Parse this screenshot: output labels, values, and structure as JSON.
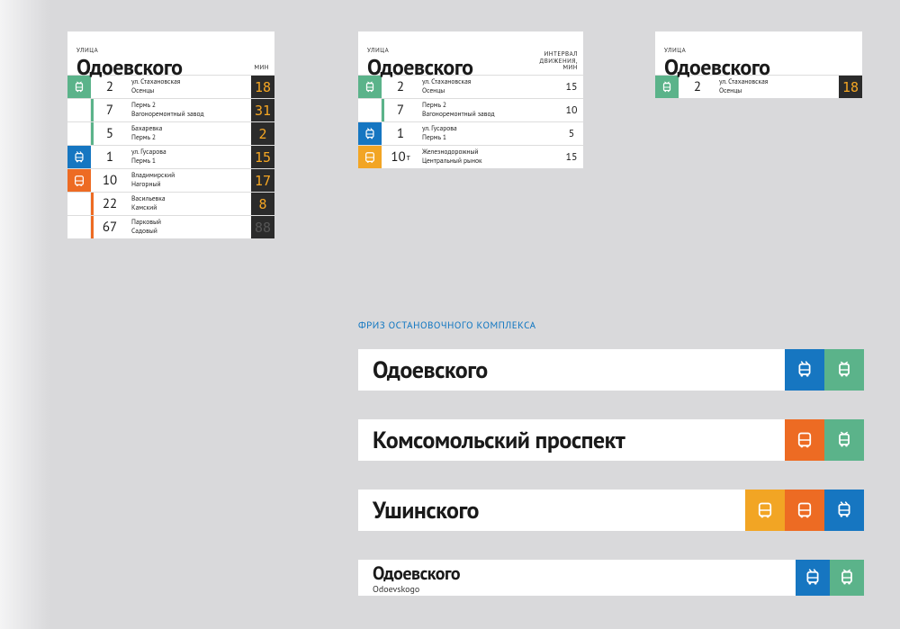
{
  "labels": {
    "street": "УЛИЦА",
    "min": "МИН",
    "interval": "ИНТЕРВАЛ ДВИЖЕНИЯ, МИН"
  },
  "panel1": {
    "title": "Одоевского",
    "rows": [
      {
        "icon": "tram",
        "color": "green",
        "num": "2",
        "dest1": "ул. Стахановская",
        "dest2": "Осенцы",
        "time": "18"
      },
      {
        "icon": "",
        "color": "",
        "accent": "green",
        "num": "7",
        "dest1": "Пермь 2",
        "dest2": "Вагоноремонтный завод",
        "time": "31"
      },
      {
        "icon": "",
        "color": "",
        "accent": "green",
        "num": "5",
        "dest1": "Бахаревка",
        "dest2": "Пермь 2",
        "time": "2"
      },
      {
        "icon": "trolley",
        "color": "blue",
        "num": "1",
        "dest1": "ул. Гусарова",
        "dest2": "Пермь 1",
        "time": "15"
      },
      {
        "icon": "bus",
        "color": "orange",
        "num": "10",
        "dest1": "Владимирский",
        "dest2": "Нагорный",
        "time": "17"
      },
      {
        "icon": "",
        "color": "",
        "accent": "orange",
        "num": "22",
        "dest1": "Васильевка",
        "dest2": "Камский",
        "time": "8"
      },
      {
        "icon": "",
        "color": "",
        "accent": "orange",
        "num": "67",
        "dest1": "Парковый",
        "dest2": "Садовый",
        "time": "88",
        "dim": true
      }
    ]
  },
  "panel2": {
    "title": "Одоевского",
    "rows": [
      {
        "icon": "tram",
        "color": "green",
        "num": "2",
        "dest1": "ул. Стахановская",
        "dest2": "Осенцы",
        "time": "15"
      },
      {
        "icon": "",
        "color": "",
        "accent": "green",
        "num": "7",
        "dest1": "Пермь 2",
        "dest2": "Вагоноремонтный завод",
        "time": "10"
      },
      {
        "icon": "trolley",
        "color": "blue",
        "num": "1",
        "dest1": "ул. Гусарова",
        "dest2": "Пермь 1",
        "time": "5"
      },
      {
        "icon": "bus",
        "color": "yellow",
        "num": "10",
        "suffix": "т",
        "dest1": "Железнодорожный",
        "dest2": "Центральный рынок",
        "time": "15"
      }
    ]
  },
  "panel3": {
    "title": "Одоевского",
    "rows": [
      {
        "icon": "tram",
        "color": "green",
        "num": "2",
        "dest1": "ул. Стахановская",
        "dest2": "Осенцы",
        "time": "18"
      }
    ]
  },
  "section_title": "ФРИЗ ОСТАНОВОЧНОГО КОМПЛЕКСА",
  "friezes": [
    {
      "title": "Одоевского",
      "icons": [
        {
          "icon": "trolley",
          "color": "blue"
        },
        {
          "icon": "tram",
          "color": "green"
        }
      ]
    },
    {
      "title": "Комсомольский проспект",
      "icons": [
        {
          "icon": "bus",
          "color": "orange"
        },
        {
          "icon": "tram",
          "color": "green"
        }
      ]
    },
    {
      "title": "Ушинского",
      "icons": [
        {
          "icon": "bus",
          "color": "yellow"
        },
        {
          "icon": "bus",
          "color": "orange"
        },
        {
          "icon": "trolley",
          "color": "blue"
        }
      ]
    },
    {
      "title": "Одоевского",
      "sub": "Odoevskogo",
      "small": true,
      "icons": [
        {
          "icon": "trolley",
          "color": "blue"
        },
        {
          "icon": "tram",
          "color": "green"
        }
      ]
    }
  ]
}
